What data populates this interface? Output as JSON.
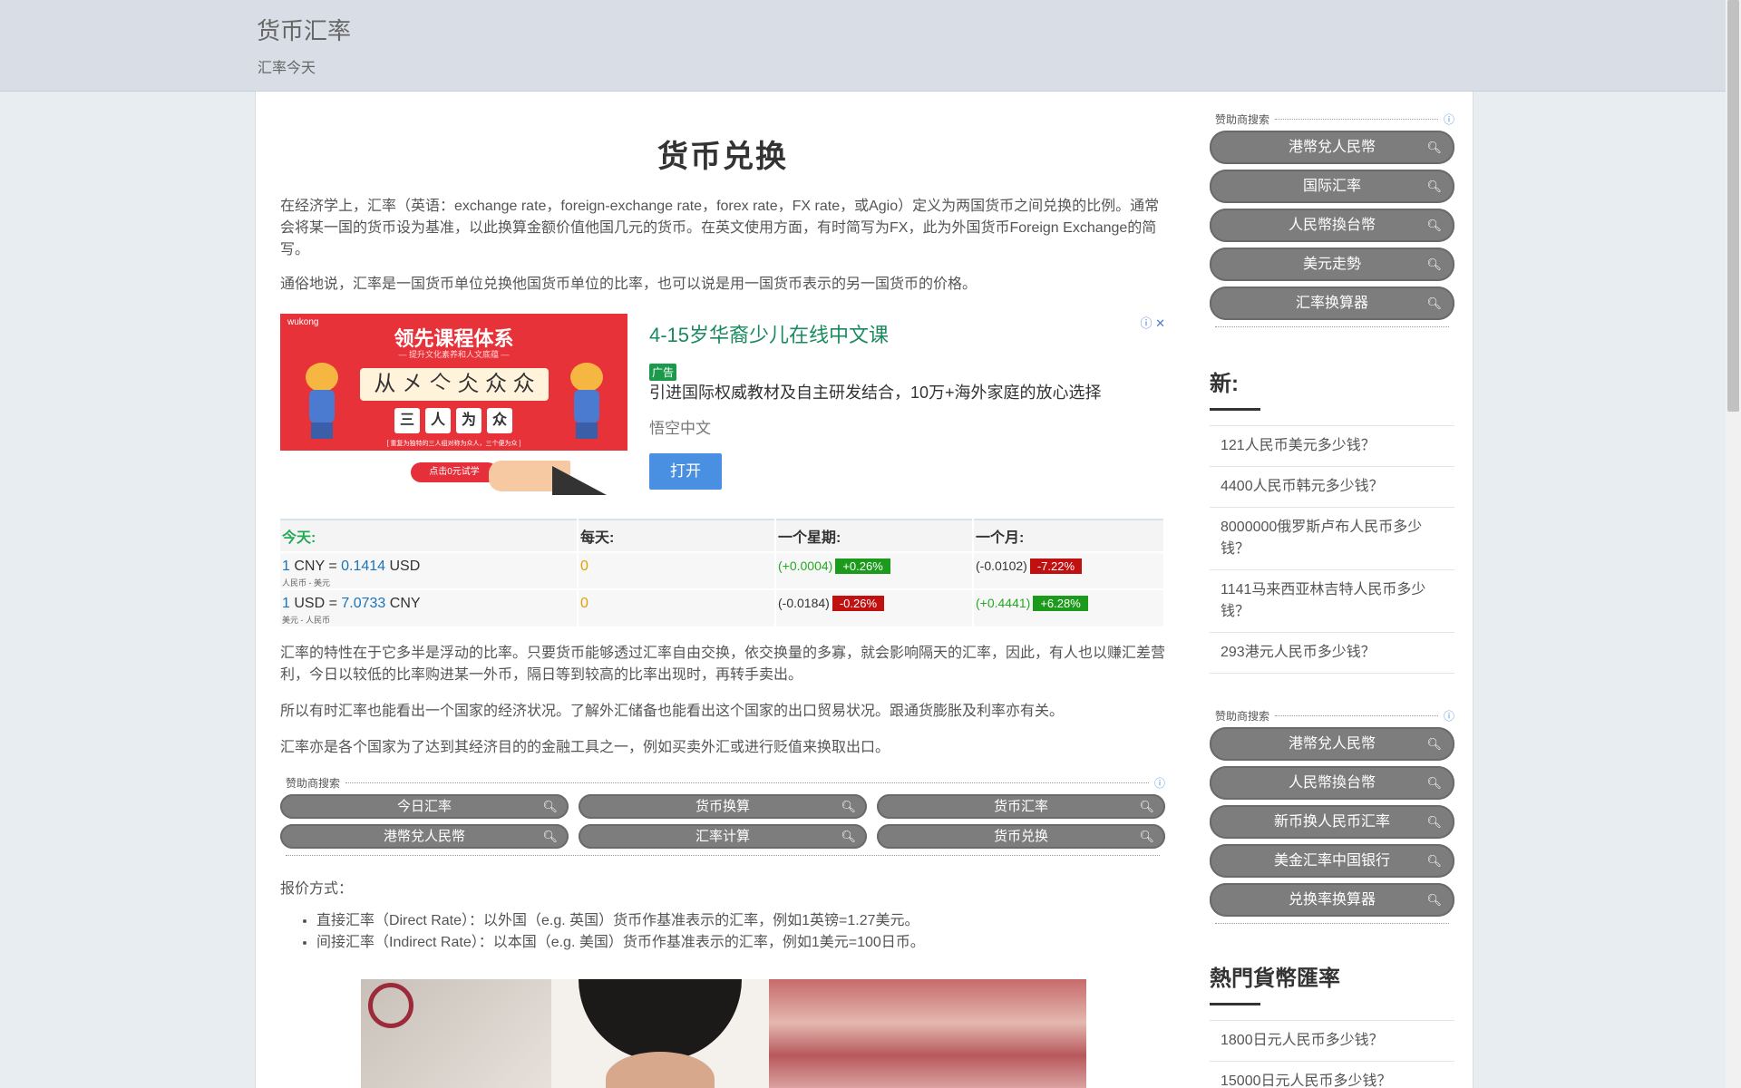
{
  "header": {
    "site_title": "货币汇率",
    "site_subtitle": "汇率今天"
  },
  "main": {
    "title": "货币兑换",
    "intro": [
      "在经济学上，汇率（英语：exchange rate，foreign-exchange rate，forex rate，FX rate，或Agio）定义为两国货币之间兑换的比例。通常会将某一国的货币设为基准，以此换算金额价值他国几元的货币。在英文使用方面，有时简写为FX，此为外国货币Foreign Exchange的简写。",
      "通俗地说，汇率是一国货币单位兑换他国货币单位的比率，也可以说是用一国货币表示的另一国货币的价格。"
    ],
    "ad": {
      "brand": "wukong",
      "image_title": "领先课程体系",
      "image_sub": "— 提升文化素养和人文底蕴 —",
      "image_box": "从 㐅 亽 仌 众 众",
      "image_row": [
        "三",
        "人",
        "为",
        "众"
      ],
      "image_note": "[ 重复为独特的三人组对称为众人，三个便为众 ]",
      "cta_pill": "点击0元试学",
      "headline": "4-15岁华裔少儿在线中文课",
      "close": "ⓘ ✕",
      "badge": "广告",
      "body": "引进国际权威教材及自主研发结合，10万+海外家庭的放心选择",
      "advertiser": "悟空中文",
      "open": "打开"
    },
    "rates": {
      "headers": [
        "今天:",
        "每天:",
        "一个星期:",
        "一个月:"
      ],
      "rows": [
        {
          "amount": "1",
          "from": "CNY",
          "eq": "=",
          "rate": "0.1414",
          "to": "USD",
          "pair_label": "人民币 - 美元",
          "daily": "0",
          "week_change": "(+0.0004)",
          "week_pct": "+0.26%",
          "month_change": "(-0.0102)",
          "month_pct": "-7.22%"
        },
        {
          "amount": "1",
          "from": "USD",
          "eq": "=",
          "rate": "7.0733",
          "to": "CNY",
          "pair_label": "美元 - 人民币",
          "daily": "0",
          "week_change": "(-0.0184)",
          "week_pct": "-0.26%",
          "month_change": "(+0.4441)",
          "month_pct": "+6.28%"
        }
      ]
    },
    "body": [
      "汇率的特性在于它多半是浮动的比率。只要货币能够透过汇率自由交换，依交换量的多寡，就会影响隔天的汇率，因此，有人也以赚汇差营利，今日以较低的比率购进某一外币，隔日等到较高的比率出现时，再转手卖出。",
      "所以有时汇率也能看出一个国家的经济状况。了解外汇储备也能看出这个国家的出口贸易状况。跟通货膨胀及利率亦有关。",
      "汇率亦是各个国家为了达到其经济目的的金融工具之一，例如买卖外汇或进行贬值来换取出口。"
    ],
    "sponsor": {
      "label": "赞助商搜索",
      "info": "ⓘ",
      "items": [
        "今日汇率",
        "货币换算",
        "货币汇率",
        "港幣兌人民幣",
        "汇率计算",
        "货币兑换"
      ]
    },
    "quote_title": "报价方式：",
    "quotes": [
      "直接汇率（Direct Rate）：以外国（e.g. 英国）货币作基准表示的汇率，例如1英镑=1.27美元。",
      "间接汇率（Indirect Rate）：以本国（e.g. 美国）货币作基准表示的汇率，例如1美元=100日币。"
    ]
  },
  "sidebar": {
    "sponsor_top": {
      "label": "赞助商搜索",
      "info": "ⓘ",
      "items": [
        "港幣兌人民幣",
        "国际汇率",
        "人民幣換台幣",
        "美元走勢",
        "汇率换算器"
      ]
    },
    "new_heading": "新:",
    "new_items": [
      "121人民币美元多少钱？",
      "4400人民币韩元多少钱？",
      "8000000俄罗斯卢布人民币多少钱？",
      "1141马来西亚林吉特人民币多少钱？",
      "293港元人民币多少钱？"
    ],
    "sponsor_bottom": {
      "label": "赞助商搜索",
      "info": "ⓘ",
      "items": [
        "港幣兌人民幣",
        "人民幣換台幣",
        "新币换人民币汇率",
        "美金汇率中国银行",
        "兑换率换算器"
      ]
    },
    "hot_heading": "熱門貨幣匯率",
    "hot_items": [
      "1800日元人民币多少钱？",
      "15000日元人民币多少钱？"
    ]
  }
}
